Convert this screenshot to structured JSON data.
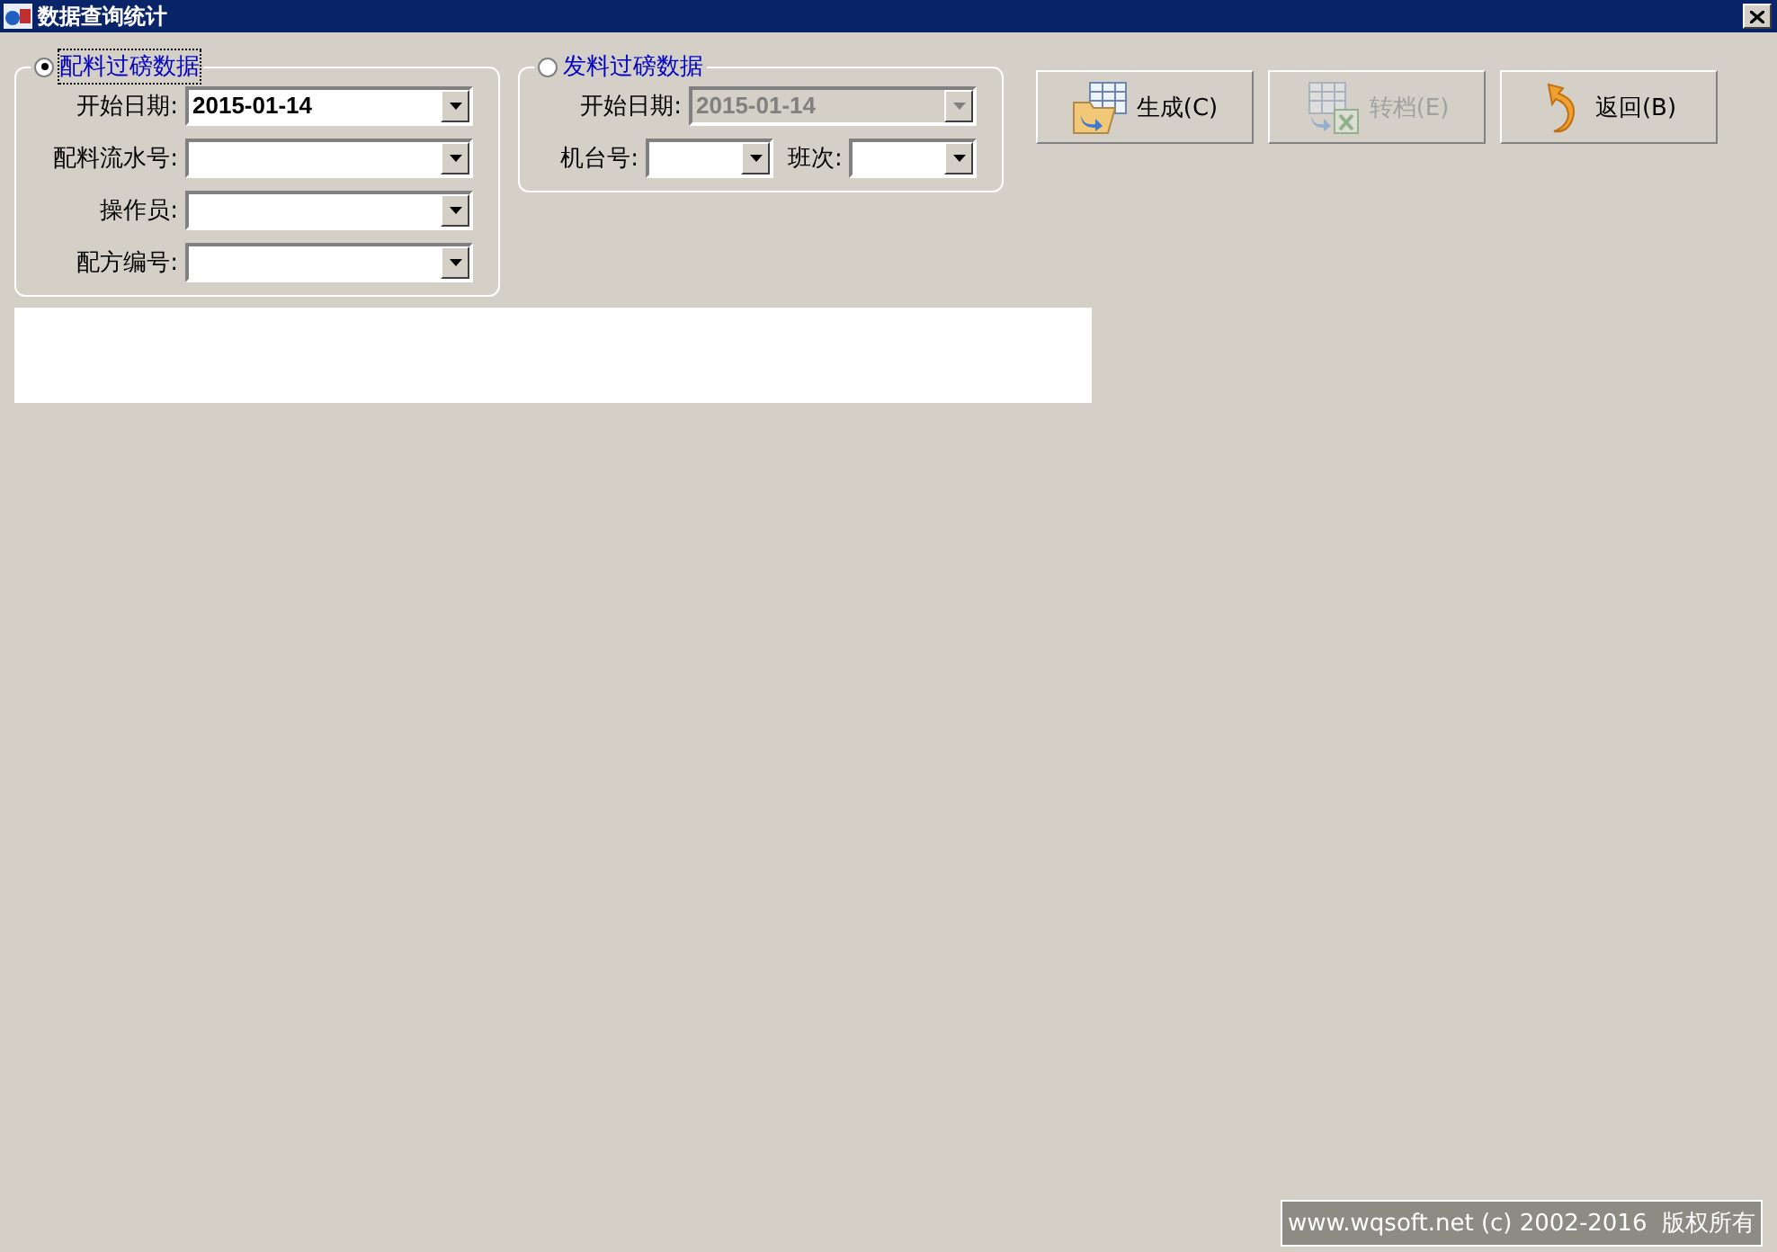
{
  "window": {
    "title": "数据查询统计"
  },
  "groups": [
    {
      "label": "配料过磅数据",
      "selected": true,
      "rows": [
        [
          {
            "label": "开始日期:",
            "value": "2015-01-14",
            "disabled": false
          }
        ],
        [
          {
            "label": "配料流水号:",
            "disabled": false
          }
        ],
        [
          {
            "label": "操作员:",
            "disabled": false
          }
        ],
        [
          {
            "label": "配方编号:",
            "disabled": false
          }
        ]
      ]
    },
    {
      "label": "发料过磅数据",
      "selected": false,
      "rows": [
        [
          {
            "label": "开始日期:",
            "value": "2015-01-14",
            "disabled": true
          }
        ],
        [
          {
            "label": "机台号:",
            "disabled": false
          },
          {
            "label": "班次:",
            "disabled": false
          }
        ]
      ]
    }
  ],
  "buttons": [
    {
      "label": "生成(C)",
      "kind": "generate",
      "disabled": false
    },
    {
      "label": "转档(E)",
      "kind": "export",
      "disabled": true
    },
    {
      "label": "返回(B)",
      "kind": "back",
      "disabled": false
    }
  ],
  "footer": "www.wqsoft.net (c) 2002-2016  版权所有"
}
